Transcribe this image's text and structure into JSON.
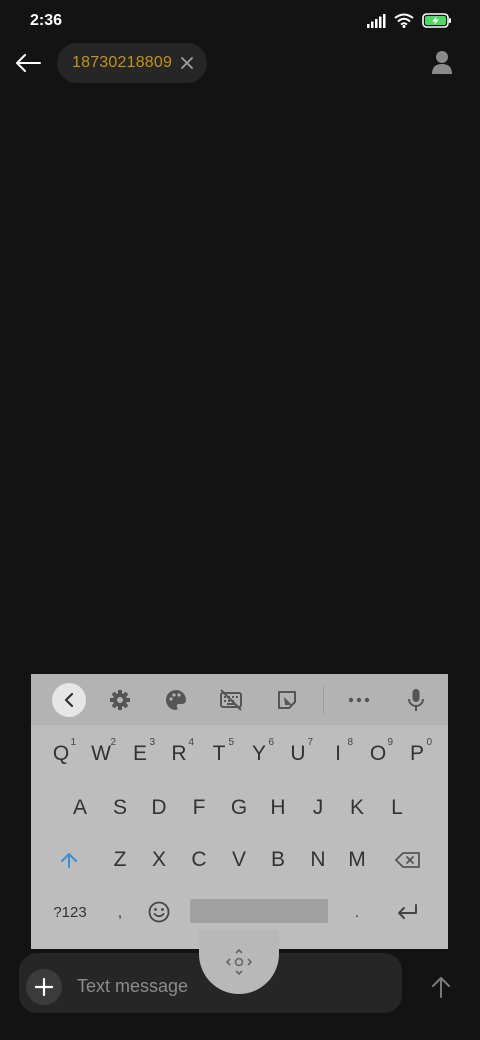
{
  "status_bar": {
    "time": "2:36"
  },
  "header": {
    "recipient": "18730218809"
  },
  "keyboard": {
    "rows": [
      [
        {
          "label": "Q",
          "hint": "1"
        },
        {
          "label": "W",
          "hint": "2"
        },
        {
          "label": "E",
          "hint": "3"
        },
        {
          "label": "R",
          "hint": "4"
        },
        {
          "label": "T",
          "hint": "5"
        },
        {
          "label": "Y",
          "hint": "6"
        },
        {
          "label": "U",
          "hint": "7"
        },
        {
          "label": "I",
          "hint": "8"
        },
        {
          "label": "O",
          "hint": "9"
        },
        {
          "label": "P",
          "hint": "0"
        }
      ],
      [
        {
          "label": "A"
        },
        {
          "label": "S"
        },
        {
          "label": "D"
        },
        {
          "label": "F"
        },
        {
          "label": "G"
        },
        {
          "label": "H"
        },
        {
          "label": "J"
        },
        {
          "label": "K"
        },
        {
          "label": "L"
        }
      ],
      [
        {
          "label": "Z"
        },
        {
          "label": "X"
        },
        {
          "label": "C"
        },
        {
          "label": "V"
        },
        {
          "label": "B"
        },
        {
          "label": "N"
        },
        {
          "label": "M"
        }
      ]
    ],
    "symbols_label": "?123",
    "comma_label": ",",
    "period_label": "."
  },
  "compose": {
    "placeholder": "Text message"
  },
  "colors": {
    "background": "#131313",
    "recipient_text": "#c39413",
    "keyboard": "#bdbdbd",
    "shift_active": "#3b8fd0"
  },
  "icons": [
    "back-arrow-icon",
    "close-icon",
    "contact-icon",
    "signal-icon",
    "wifi-icon",
    "battery-charging-icon",
    "chevron-left-icon",
    "gear-icon",
    "palette-icon",
    "keyboard-off-icon",
    "clipboard-icon",
    "more-icon",
    "mic-icon",
    "shift-icon",
    "emoji-icon",
    "backspace-icon",
    "move-handle-icon",
    "plus-icon",
    "send-arrow-icon"
  ]
}
